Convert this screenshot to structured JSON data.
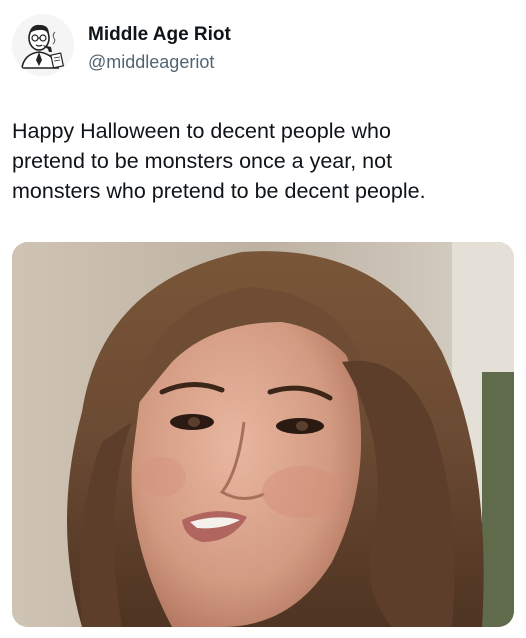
{
  "author": {
    "display_name": "Middle Age Riot",
    "handle": "@middleageriot",
    "avatar_icon": "vintage-man-cartoon-avatar-icon"
  },
  "tweet": {
    "text_lines": [
      "Happy Halloween to decent people who",
      "pretend to be monsters once a year, not",
      "monsters who pretend to be decent people."
    ]
  },
  "media": {
    "subject": "close-up-photo-woman-long-brown-hair",
    "colors": {
      "background_wall": "#c9bfb3",
      "hair": "#6b4a33",
      "skin": "#d9a38c",
      "lips": "#b0655e"
    }
  }
}
